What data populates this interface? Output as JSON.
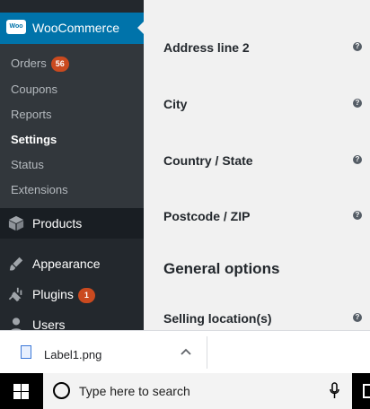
{
  "sidebar": {
    "woocommerce_label": "WooCommerce",
    "woo_logo_text": "Woo",
    "submenu": [
      {
        "label": "Orders",
        "badge": "56"
      },
      {
        "label": "Coupons"
      },
      {
        "label": "Reports"
      },
      {
        "label": "Settings",
        "current": true
      },
      {
        "label": "Status"
      },
      {
        "label": "Extensions"
      }
    ],
    "products_label": "Products",
    "appearance_label": "Appearance",
    "plugins_label": "Plugins",
    "plugins_badge": "1",
    "users_label": "Users"
  },
  "main": {
    "fields": [
      {
        "label": "Address line 2"
      },
      {
        "label": "City"
      },
      {
        "label": "Country / State"
      },
      {
        "label": "Postcode / ZIP"
      }
    ],
    "section_title": "General options",
    "selling_locations_label": "Selling location(s)",
    "help_glyph": "?"
  },
  "download_bar": {
    "file_name": "Label1.png",
    "chevron_glyph": "^"
  },
  "taskbar": {
    "search_placeholder": "Type here to search"
  },
  "colors": {
    "admin_menu_bg": "#23282d",
    "admin_submenu_bg": "#32373c",
    "active_menu": "#0073aa",
    "badge": "#ca4a1f"
  }
}
